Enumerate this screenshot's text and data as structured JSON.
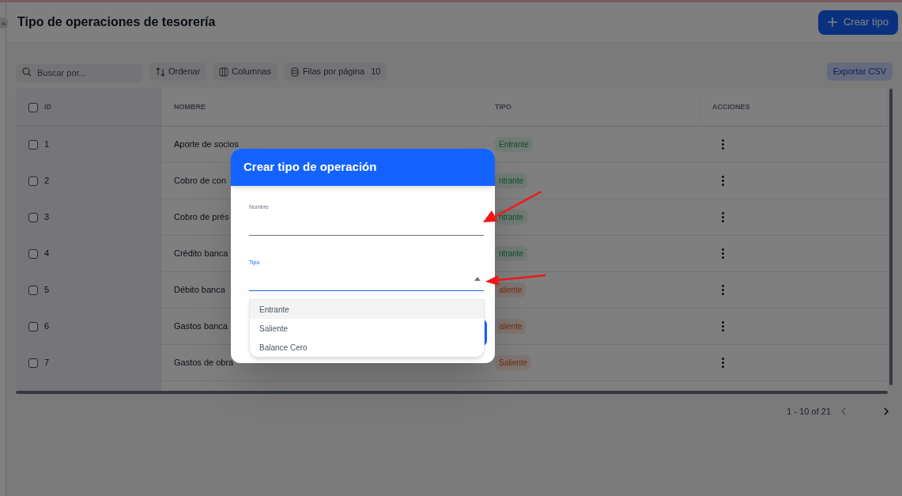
{
  "sidebar": {
    "collapse_glyph": "«"
  },
  "header": {
    "title": "Tipo de operaciones de tesorería",
    "create_button": "Crear tipo"
  },
  "toolbar": {
    "search_placeholder": "Buscar por...",
    "sort_button": "Ordenar",
    "columns_button": "Columnas",
    "rows_per_page_label": "Filas por página",
    "rows_per_page_value": "10",
    "export_button": "Exportar CSV"
  },
  "table": {
    "all_checked": false,
    "columns": [
      {
        "label": "ID"
      },
      {
        "label": "NOMBRE"
      },
      {
        "label": "TIPO"
      },
      {
        "label": "ACCIONES"
      }
    ],
    "rows": [
      {
        "id": "1",
        "name": "Aporte de socios",
        "type": "Entrante",
        "kind": "incoming",
        "checked": false
      },
      {
        "id": "2",
        "name": "Cobro de con",
        "type": "ntrante",
        "kind": "incoming",
        "checked": false
      },
      {
        "id": "3",
        "name": "Cobro de prés",
        "type": "ntrante",
        "kind": "incoming",
        "checked": false
      },
      {
        "id": "4",
        "name": "Crédito banca",
        "type": "ntrante",
        "kind": "incoming",
        "checked": false
      },
      {
        "id": "5",
        "name": "Débito banca",
        "type": "aliente",
        "kind": "outgoing",
        "checked": false
      },
      {
        "id": "6",
        "name": "Gastos banca",
        "type": "aliente",
        "kind": "outgoing",
        "checked": false
      },
      {
        "id": "7",
        "name": "Gastos de obra",
        "type": "Saliente",
        "kind": "outgoing",
        "checked": false
      }
    ]
  },
  "pagination": {
    "range": "1 - 10 of 21"
  },
  "modal": {
    "title": "Crear tipo de operación",
    "fields": [
      {
        "kind": "text",
        "label": "Nombre",
        "focused": false
      },
      {
        "kind": "select",
        "label": "Tipo",
        "focused": true,
        "expanded": true
      }
    ],
    "options": [
      {
        "label": "Entrante",
        "selected": true
      },
      {
        "label": "Saliente",
        "selected": false
      },
      {
        "label": "Balance Cero",
        "selected": false
      }
    ]
  }
}
